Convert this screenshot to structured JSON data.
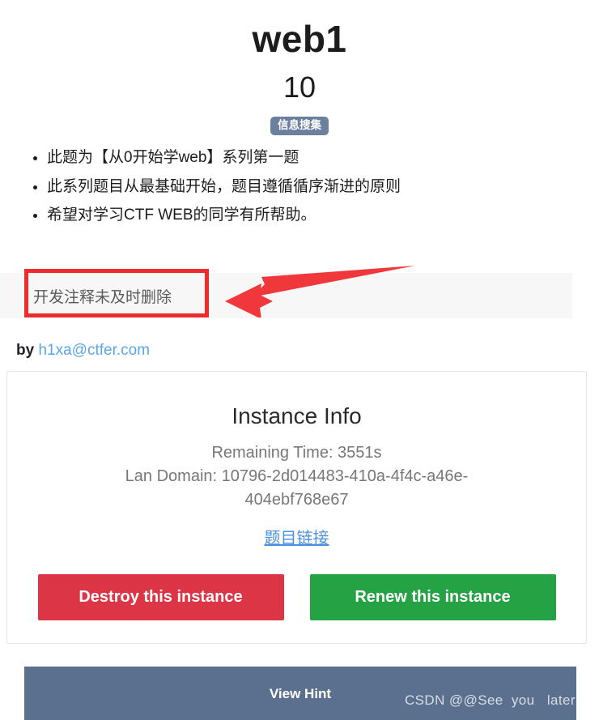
{
  "header": {
    "title": "web1",
    "score": "10",
    "category_badge": "信息搜集"
  },
  "description": {
    "items": [
      "此题为【从0开始学web】系列第一题",
      "此系列题目从最基础开始，题目遵循循序渐进的原则",
      "希望对学习CTF WEB的同学有所帮助。"
    ]
  },
  "annotation": {
    "comment_text": "开发注释未及时删除",
    "rect_color": "#f02b2b",
    "arrow_color": "#f0373b"
  },
  "author": {
    "prefix": "by",
    "email": "h1xa@ctfer.com"
  },
  "instance": {
    "title": "Instance Info",
    "remaining_time": "Remaining Time: 3551s",
    "lan_domain": "Lan Domain: 10796-2d014483-410a-4f4c-a46e-404ebf768e67",
    "link_label": "题目链接",
    "destroy_label": "Destroy this instance",
    "renew_label": "Renew this instance",
    "destroy_color": "#dc3545",
    "renew_color": "#25a244"
  },
  "hint": {
    "label": "View Hint",
    "bar_color": "#5b708f"
  },
  "watermark": {
    "text": "CSDN @@See  you   later"
  }
}
